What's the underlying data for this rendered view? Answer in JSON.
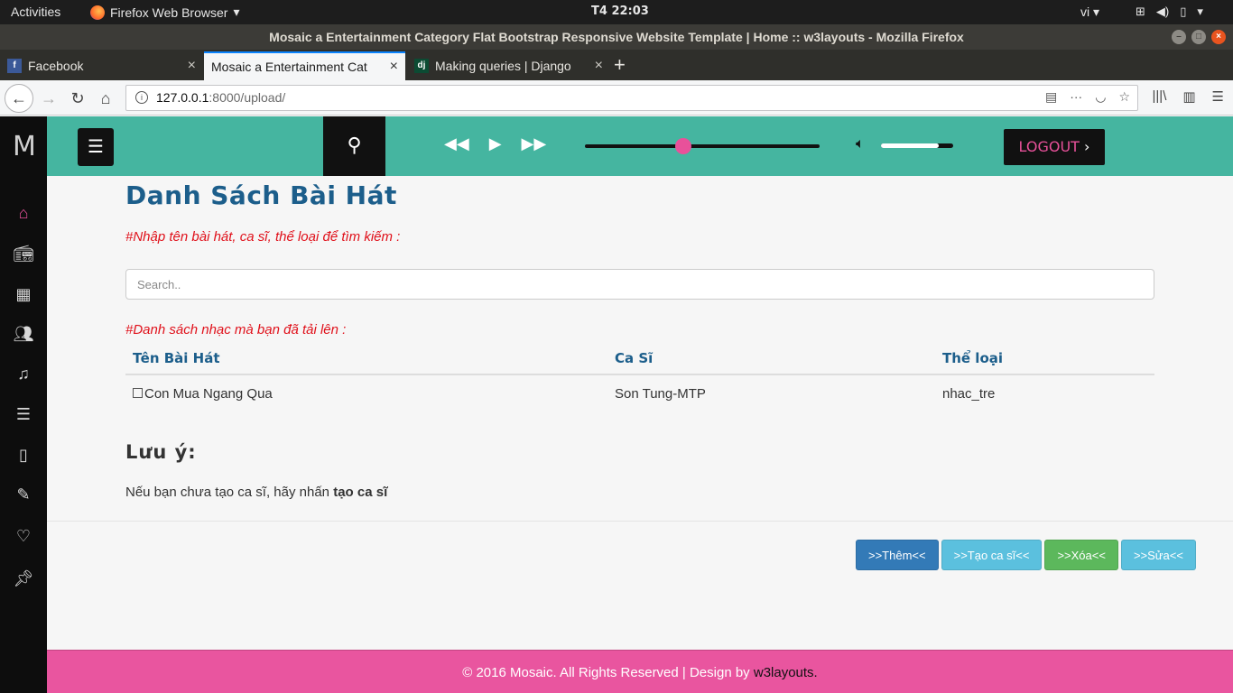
{
  "system": {
    "activities": "Activities",
    "app_menu": "Firefox Web Browser",
    "clock": "T4 22:03",
    "language": "vi"
  },
  "window": {
    "title": "Mosaic a Entertainment Category Flat Bootstrap Responsive Website Template | Home :: w3layouts - Mozilla Firefox"
  },
  "tabs": [
    {
      "title": "Facebook",
      "favicon": "facebook-icon",
      "active": false
    },
    {
      "title": "Mosaic a Entertainment Cat",
      "favicon": "page-icon",
      "active": true
    },
    {
      "title": "Making queries | Django",
      "favicon": "django-icon",
      "active": false
    }
  ],
  "urlbar": {
    "host": "127.0.0.1",
    "path": ":8000/upload/"
  },
  "site": {
    "logo": "M",
    "logout_label": "LOGOUT",
    "player": {
      "seek_progress": 0.42,
      "volume": 0.8
    },
    "sidebar_icons": [
      "home-icon",
      "radio-icon",
      "grid-icon",
      "users-icon",
      "music-note-icon",
      "playlist-icon",
      "book-icon",
      "pencil-icon",
      "heart-icon",
      "pin-icon"
    ]
  },
  "main": {
    "title": "Danh Sách Bài Hát",
    "search_hint": "#Nhập tên bài hát, ca sĩ, thể loại để tìm kiếm :",
    "search_placeholder": "Search..",
    "list_hint": "#Danh sách nhạc mà bạn đã tải lên :",
    "table": {
      "headers": [
        "Tên Bài Hát",
        "Ca Sĩ",
        "Thể loại"
      ],
      "rows": [
        {
          "song": "Con Mua Ngang Qua",
          "singer": "Son Tung-MTP",
          "genre": "nhac_tre"
        }
      ]
    },
    "note_heading": "Lưu ý:",
    "note_text": "Nếu bạn chưa tạo ca sĩ, hãy nhấn",
    "note_strong": "tạo ca sĩ",
    "actions": {
      "add": ">>Thêm<<",
      "create_singer": ">>Tạo ca sĩ<<",
      "delete": ">>Xóa<<",
      "edit": ">>Sửa<<"
    }
  },
  "footer": {
    "text": "© 2016 Mosaic. All Rights Reserved | Design by",
    "link": "w3layouts."
  },
  "colors": {
    "header": "#45b5a0",
    "accent": "#e8519a",
    "title": "#1c5e8b",
    "footer": "#e9559f"
  }
}
